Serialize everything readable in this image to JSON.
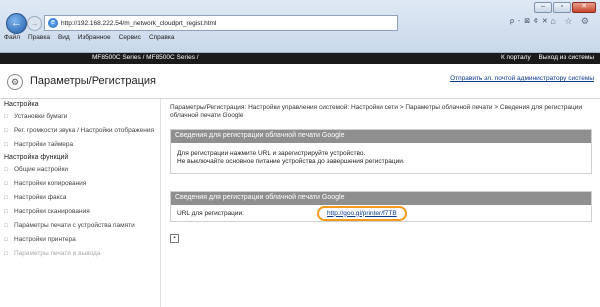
{
  "browser": {
    "url": "http://192.168.222.54/m_network_cloudprt_regist.html",
    "tools": "ρ - ⊠ ¢ ✕",
    "right_icons": "⌂ ☆ ⚙",
    "back_glyph": "←",
    "forward_glyph": "→",
    "window_buttons": [
      "–",
      "▫",
      "✕"
    ]
  },
  "menu": [
    "Файл",
    "Правка",
    "Вид",
    "Избранное",
    "Сервис",
    "Справка"
  ],
  "topbar": {
    "model": "MF8500C Series / MF8500C Series /",
    "link_portal": "К порталу",
    "link_logout": "Выход из системы"
  },
  "header": {
    "title": "Параметры/Регистрация",
    "admin_link": "Отправить эл. почтой администратору системы"
  },
  "sidebar": {
    "heading_settings": "Настройка",
    "items_settings": [
      "Установки бумаги",
      "Рег. громкости звука / Настройки отображения",
      "Настройки таймера"
    ],
    "heading_functions": "Настройка функций",
    "items_functions": [
      "Общие настройки",
      "Настройки копирования",
      "Настройки факса",
      "Настройки сканирования",
      "Параметры печати с устройства памяти",
      "Настройки принтера",
      "Параметры печати и вывода"
    ]
  },
  "main": {
    "breadcrumb": "Параметры/Регистрация: Настройки управления системой: Настройки сети > Параметры облачной печати > Сведения для регистрации облачной печати Google",
    "panel1": {
      "header": "Сведения для регистрации облачной печати Google",
      "line1": "Для регистрации нажмите URL и зарегистрируйте устройство.",
      "line2": "Не выключайте основное питание устройства до завершения регистрации."
    },
    "panel2": {
      "header": "Сведения для регистрации облачной печати Google",
      "label": "URL для регистрации:",
      "link": "http://goo.gl/printer/f7TB"
    },
    "expand_glyph": "▪"
  }
}
